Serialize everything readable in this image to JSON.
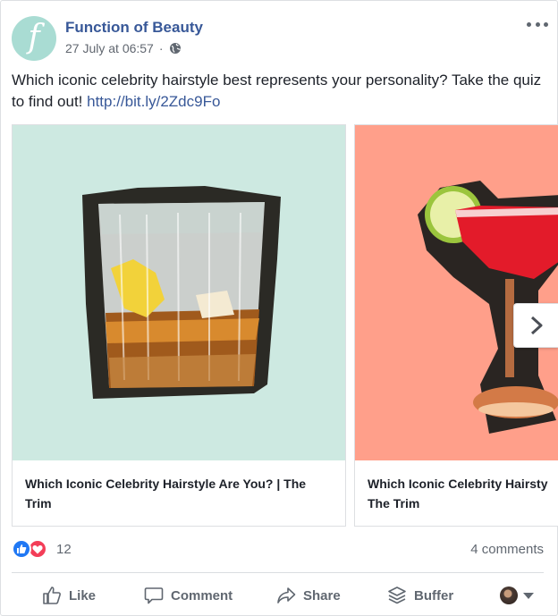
{
  "post": {
    "page_name": "Function of Beauty",
    "avatar_letter": "f",
    "timestamp": "27 July at 06:57",
    "separator": "·",
    "text": "Which iconic celebrity hairstyle best represents your personality? Take the quiz to find out!",
    "link": "http://bit.ly/2Zdc9Fo"
  },
  "carousel": {
    "cards": [
      {
        "title": "Which Iconic Celebrity Hairstyle Are You? | The Trim",
        "image": "whiskey-glass",
        "background": "#cde9e1"
      },
      {
        "title": "Which Iconic Celebrity Hairsty The Trim",
        "title_line1": "Which Iconic Celebrity Hairsty",
        "title_line2": "The Trim",
        "image": "margarita-glass",
        "background": "#ff9f8a"
      }
    ],
    "next_icon": "chevron-right-icon"
  },
  "reactions": {
    "icons": [
      "like-reaction-icon",
      "love-reaction-icon"
    ],
    "count": "12",
    "comments": "4 comments"
  },
  "actions": {
    "like": "Like",
    "comment": "Comment",
    "share": "Share",
    "buffer": "Buffer"
  },
  "colors": {
    "link": "#385898",
    "text": "#1d2129",
    "muted": "#606770",
    "like_blue": "#2078f4",
    "love_red": "#f33e58"
  }
}
